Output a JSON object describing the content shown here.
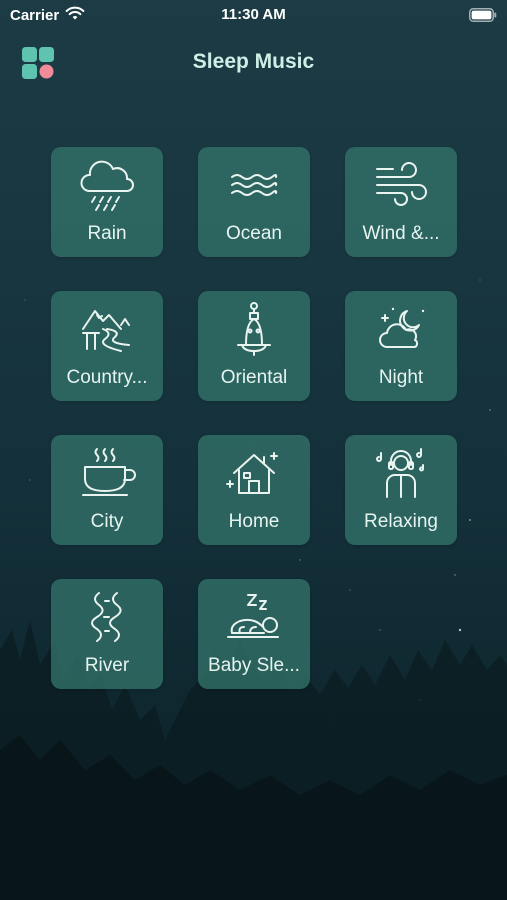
{
  "status_bar": {
    "carrier": "Carrier",
    "time": "11:30 AM"
  },
  "header": {
    "title": "Sleep Music",
    "menu_icon": "grid-apps-icon"
  },
  "categories": [
    {
      "label": "Rain",
      "icon": "rain-cloud-icon"
    },
    {
      "label": "Ocean",
      "icon": "waves-icon"
    },
    {
      "label": "Wind &...",
      "icon": "wind-icon"
    },
    {
      "label": "Country...",
      "icon": "mountain-path-icon"
    },
    {
      "label": "Oriental",
      "icon": "temple-bell-icon"
    },
    {
      "label": "Night",
      "icon": "moon-cloud-icon"
    },
    {
      "label": "City",
      "icon": "coffee-cup-icon"
    },
    {
      "label": "Home",
      "icon": "house-icon"
    },
    {
      "label": "Relaxing",
      "icon": "headphones-person-icon"
    },
    {
      "label": "River",
      "icon": "river-icon"
    },
    {
      "label": "Baby Sle...",
      "icon": "sleeping-baby-icon"
    }
  ],
  "colors": {
    "tile_background": "#327068",
    "title": "#cfeee6",
    "icon_stroke": "#e9f3ef",
    "menu_teal": "#5ec4b0",
    "menu_pink": "#f08c9a"
  }
}
